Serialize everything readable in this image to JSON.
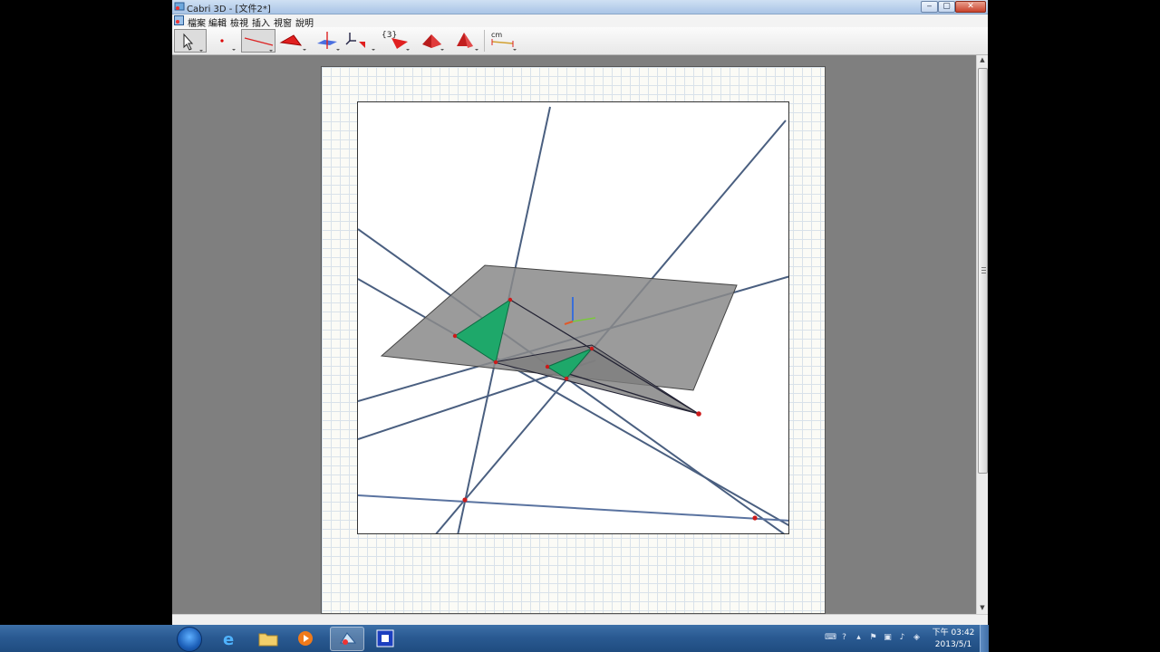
{
  "window": {
    "title": "Cabri 3D - [文件2*]",
    "controls": [
      "‒",
      "▢",
      "✕"
    ]
  },
  "menu": [
    "檔案",
    "編輯",
    "檢視",
    "插入",
    "視窗",
    "說明"
  ],
  "toolbar": {
    "tools": [
      "pointer",
      "point",
      "line",
      "polygon",
      "perpendicular",
      "transformation",
      "regular-polygon",
      "polyhedron",
      "pyramid",
      "measurement"
    ],
    "selected": "line",
    "set_label": "{3}",
    "measure_label": "cm"
  },
  "scene": {
    "plane_color": "#8a8a8a",
    "triangle_color": "#1ea86a",
    "line_color": "#4a5f80",
    "point_color": "#cc1a1a"
  },
  "taskbar": {
    "apps": [
      "internet-explorer",
      "file-explorer",
      "media-player",
      "cabri-3d",
      "blue-app"
    ],
    "active": "cabri-3d"
  },
  "tray": {
    "time": "下午 03:42",
    "date": "2013/5/1"
  }
}
